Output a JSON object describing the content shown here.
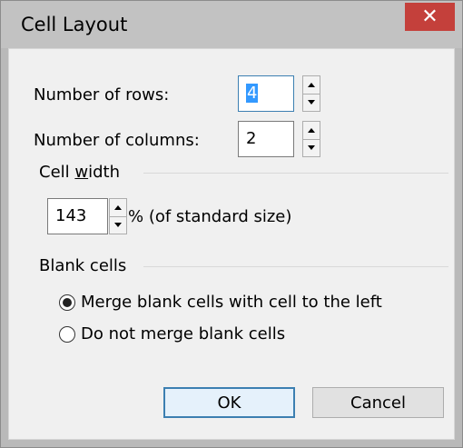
{
  "dialog": {
    "title": "Cell Layout",
    "close_glyph": "✕"
  },
  "rows": {
    "label": "Number of rows:",
    "value": "4"
  },
  "columns": {
    "label": "Number of columns:",
    "value": "2"
  },
  "cell_width": {
    "section_pre": "Cell ",
    "section_underlined": "w",
    "section_post": "idth",
    "value": "143",
    "suffix": "% (of standard size)"
  },
  "blank_cells": {
    "section_label": "Blank cells",
    "options": [
      {
        "label": "Merge blank cells with cell to the left",
        "selected": true
      },
      {
        "label": "Do not merge blank cells",
        "selected": false
      }
    ]
  },
  "buttons": {
    "ok": "OK",
    "cancel": "Cancel"
  },
  "colors": {
    "close_bg": "#c4403b",
    "selection": "#3399ff",
    "focus_border": "#3c7fb1"
  }
}
